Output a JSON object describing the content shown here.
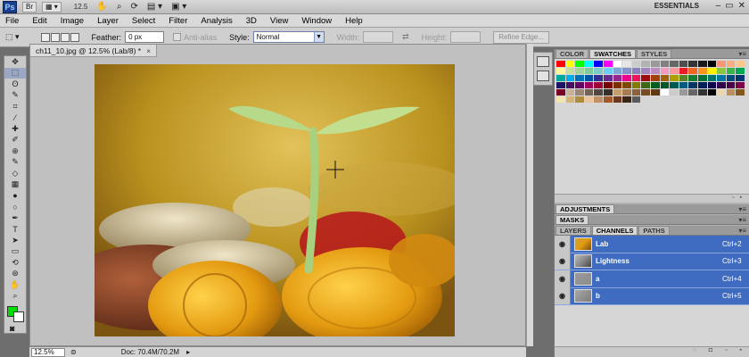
{
  "app": {
    "logo": "Ps",
    "zoom_combo": "12.5",
    "workspace": "ESSENTIALS"
  },
  "window_controls": {
    "minimize": "–",
    "restore": "▭",
    "close": "✕"
  },
  "menu": [
    "File",
    "Edit",
    "Image",
    "Layer",
    "Select",
    "Filter",
    "Analysis",
    "3D",
    "View",
    "Window",
    "Help"
  ],
  "options": {
    "feather_label": "Feather:",
    "feather_value": "0 px",
    "antialias_label": "Anti-alias",
    "style_label": "Style:",
    "style_value": "Normal",
    "width_label": "Width:",
    "height_label": "Height:",
    "refine_edge": "Refine Edge..."
  },
  "document": {
    "tab_title": "ch11_10.jpg @ 12.5% (Lab/8) *",
    "close": "×"
  },
  "status": {
    "zoom": "12.5%",
    "doc_size": "Doc: 70.4M/70.2M"
  },
  "tools": [
    "move-tool",
    "marquee-tool",
    "lasso-tool",
    "quick-select-tool",
    "crop-tool",
    "eyedropper-tool",
    "healing-tool",
    "brush-tool",
    "clone-stamp-tool",
    "history-brush-tool",
    "eraser-tool",
    "gradient-tool",
    "blur-tool",
    "dodge-tool",
    "pen-tool",
    "type-tool",
    "path-select-tool",
    "shape-tool",
    "3d-rotate-tool",
    "3d-orbit-tool",
    "hand-tool",
    "zoom-tool"
  ],
  "tool_glyphs": [
    "✥",
    "⬚",
    "ʘ",
    "✎",
    "⌗",
    "⁄",
    "✚",
    "✐",
    "⊕",
    "✎",
    "◇",
    "▦",
    "●",
    "○",
    "✒",
    "T",
    "➤",
    "▭",
    "⟲",
    "⊛",
    "✋",
    "⌕"
  ],
  "colors": {
    "foreground": "#00e000",
    "background": "#ffffff",
    "selection": "#3f6cc0"
  },
  "color_panel": {
    "tabs": [
      "COLOR",
      "SWATCHES",
      "STYLES"
    ],
    "active": "SWATCHES"
  },
  "swatches": [
    "#ff0000",
    "#ffff00",
    "#00ff00",
    "#00ffff",
    "#0000ff",
    "#ff00ff",
    "#ffffff",
    "#e6e6e6",
    "#cccccc",
    "#b3b3b3",
    "#999999",
    "#808080",
    "#666666",
    "#4d4d4d",
    "#333333",
    "#1a1a1a",
    "#000000",
    "#f7977a",
    "#f9ad81",
    "#fdc68a",
    "#fff79a",
    "#c4df9b",
    "#a2d39c",
    "#82ca9d",
    "#7bcdc8",
    "#6ecff6",
    "#7ea7d8",
    "#8493ca",
    "#8882be",
    "#a187be",
    "#bc8dbf",
    "#f49ac2",
    "#f6989d",
    "#ed1c24",
    "#f26522",
    "#f7941d",
    "#fff200",
    "#8dc73f",
    "#39b54a",
    "#00a651",
    "#00a99d",
    "#00aeef",
    "#0072bc",
    "#0054a6",
    "#2e3192",
    "#662d91",
    "#92278f",
    "#ec008c",
    "#ed145b",
    "#9e0b0f",
    "#a0410d",
    "#a36209",
    "#aba000",
    "#598527",
    "#197b30",
    "#007236",
    "#00746b",
    "#0076a3",
    "#004b80",
    "#003471",
    "#1b1464",
    "#440e62",
    "#630460",
    "#9e005d",
    "#9e0039",
    "#790000",
    "#7b2e00",
    "#7d4900",
    "#827b00",
    "#406618",
    "#005e20",
    "#005826",
    "#005952",
    "#005b7f",
    "#003663",
    "#002157",
    "#0d004c",
    "#32004b",
    "#4b0049",
    "#7b0046",
    "#7a0026",
    "#c7b299",
    "#998675",
    "#736357",
    "#534741",
    "#37302a",
    "#c69c6d",
    "#a67c52",
    "#8c6239",
    "#754c24",
    "#603913",
    "#ffffff",
    "#cccccc",
    "#999999",
    "#666666",
    "#333333",
    "#000000",
    "#e9d4b4",
    "#bd8f5c",
    "#83581f",
    "#f2e3b0",
    "#d6b470",
    "#b08a3c",
    "#e8c5a0",
    "#c48f65",
    "#a05a2c",
    "#6b3a1e",
    "#3d2514",
    "#5a5a5a"
  ],
  "adjustments": {
    "tab": "ADJUSTMENTS"
  },
  "masks": {
    "tab": "MASKS"
  },
  "channels_panel": {
    "tabs": [
      "LAYERS",
      "CHANNELS",
      "PATHS"
    ],
    "active": "CHANNELS"
  },
  "channels": [
    {
      "name": "Lab",
      "shortcut": "Ctrl+2"
    },
    {
      "name": "Lightness",
      "shortcut": "Ctrl+3"
    },
    {
      "name": "a",
      "shortcut": "Ctrl+4"
    },
    {
      "name": "b",
      "shortcut": "Ctrl+5"
    }
  ]
}
